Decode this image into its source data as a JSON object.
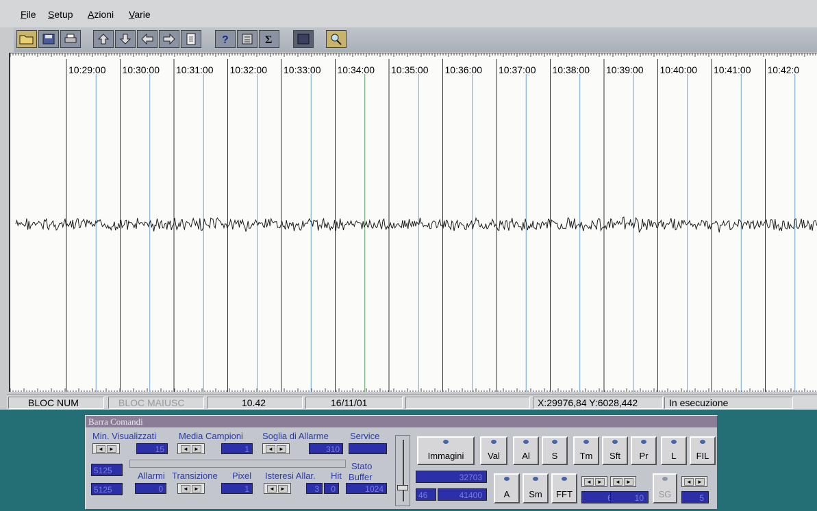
{
  "menu": {
    "items": [
      {
        "label": "File"
      },
      {
        "label": "Setup"
      },
      {
        "label": "Azioni"
      },
      {
        "label": "Varie"
      }
    ]
  },
  "toolbar": {
    "buttons": [
      {
        "icon": "open-folder-icon"
      },
      {
        "icon": "save-icon"
      },
      {
        "icon": "print-icon"
      },
      {
        "icon": "arrow-up-icon"
      },
      {
        "icon": "arrow-down-icon"
      },
      {
        "icon": "arrow-left-icon"
      },
      {
        "icon": "arrow-right-icon"
      },
      {
        "icon": "page-icon"
      },
      {
        "icon": "help-icon"
      },
      {
        "icon": "calculator-icon"
      },
      {
        "icon": "sigma-icon"
      },
      {
        "icon": "stop-icon"
      },
      {
        "icon": "magnifier-icon"
      }
    ]
  },
  "chart_data": {
    "type": "line",
    "x_ticks": [
      "10:29:00",
      "10:30:00",
      "10:31:00",
      "10:32:00",
      "10:33:00",
      "10:34:00",
      "10:35:00",
      "10:36:00",
      "10:37:00",
      "10:38:00",
      "10:39:00",
      "10:40:00",
      "10:41:00",
      "10:42:0"
    ],
    "series": [
      {
        "description": "noisy signal around mid-level"
      }
    ],
    "grid": true,
    "colors": {
      "signal": "#1a1a1a",
      "grid_dark": "#333333",
      "grid_blue": "#4a8ed0",
      "grid_green": "#2c8a3b"
    }
  },
  "status": {
    "bloc_num": "BLOC NUM",
    "bloc_maiusc": "BLOC MAIUSC",
    "time": "10.42",
    "date": "16/11/01",
    "coords": "X:29976,84 Y:6028,442",
    "state": "In esecuzione"
  },
  "panel": {
    "title": "Barra Comandi",
    "min_visualizzati": {
      "label": "Min. Visualizzati",
      "value": "15"
    },
    "media_campioni": {
      "label": "Media Campioni",
      "value": "1"
    },
    "soglia_allarme": {
      "label": "Soglia di Allarme",
      "value": "310"
    },
    "service": {
      "label": "Service"
    },
    "left_value_1": "5125",
    "left_value_2": "5125",
    "allarmi": {
      "label": "Allarmi",
      "value": "0"
    },
    "transizione": {
      "label": "Transizione"
    },
    "pixel": {
      "label": "Pixel",
      "value": "1"
    },
    "isteresi": {
      "label": "Isteresi Allar.",
      "value_a": "3",
      "value_b": "0"
    },
    "hit": {
      "label": "Hit"
    },
    "stato_buffer": {
      "label_1": "Stato",
      "label_2": "Buffer",
      "value": "1024"
    },
    "value_32703": "32703",
    "value_46": "46",
    "value_41400": "41400",
    "buttons_top": [
      "Immagini",
      "Val",
      "Al",
      "S",
      "Tm",
      "Sft",
      "Pr",
      "L",
      "FIL"
    ],
    "buttons_bottom": [
      "A",
      "Sm",
      "FFT"
    ],
    "sg_label": "SG",
    "spin_values": [
      "6",
      "10",
      "5"
    ]
  }
}
